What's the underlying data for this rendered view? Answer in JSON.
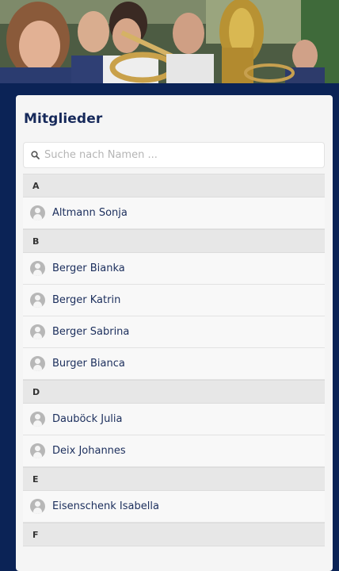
{
  "page": {
    "title": "Mitglieder"
  },
  "search": {
    "placeholder": "Suche nach Namen ..."
  },
  "groups": [
    {
      "letter": "A",
      "members": [
        "Altmann Sonja"
      ]
    },
    {
      "letter": "B",
      "members": [
        "Berger Bianka",
        "Berger Katrin",
        "Berger Sabrina",
        "Burger Bianca"
      ]
    },
    {
      "letter": "D",
      "members": [
        "Dauböck Julia",
        "Deix Johannes"
      ]
    },
    {
      "letter": "E",
      "members": [
        "Eisenschenk Isabella"
      ]
    },
    {
      "letter": "F",
      "members": []
    }
  ],
  "colors": {
    "frame": "#0b2356",
    "title": "#16295a",
    "group_header": "#e7e7e7",
    "row_background": "#f8f8f8",
    "avatar": "#b7b7b7"
  },
  "icons": {
    "search": "magnifier-icon",
    "avatar": "user-avatar-icon"
  }
}
